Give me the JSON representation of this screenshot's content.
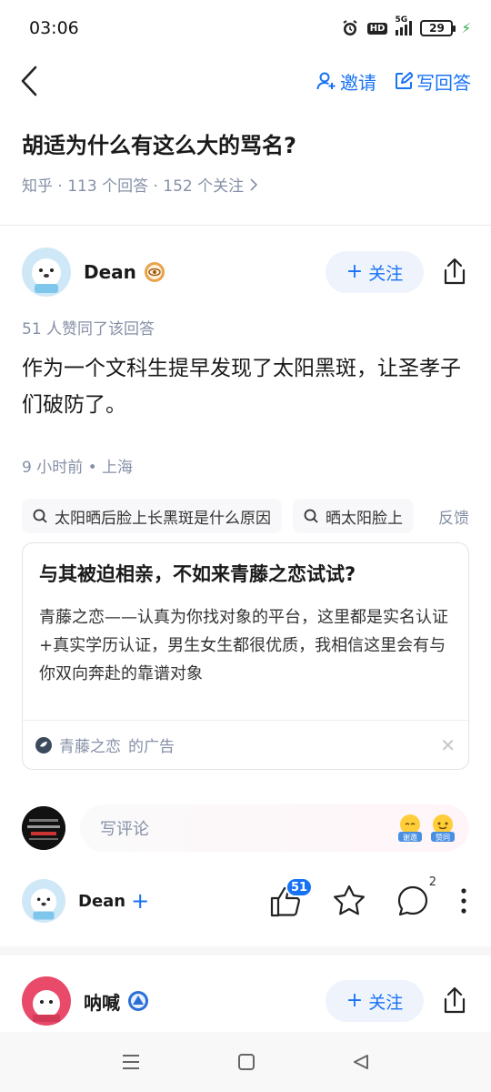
{
  "status_bar": {
    "time": "03:06",
    "hd": "HD",
    "network": "5G",
    "battery": "29"
  },
  "nav": {
    "invite_label": "邀请",
    "write_answer_label": "写回答"
  },
  "question": {
    "title": "胡适为什么有这么大的骂名?",
    "meta": "知乎 · 113 个回答 · 152 个关注"
  },
  "answer": {
    "author": "Dean",
    "follow_label": "关注",
    "likes_text": "51 人赞同了该回答",
    "content": "作为一个文科生提早发现了太阳黑斑，让圣孝子们破防了。",
    "time_location": "9 小时前 • 上海"
  },
  "search_chips": [
    "太阳晒后脸上长黑斑是什么原因",
    "晒太阳脸上"
  ],
  "feedback_label": "反馈",
  "ad": {
    "title": "与其被迫相亲，不如来青藤之恋试试?",
    "body": "青藤之恋——认真为你找对象的平台，这里都是实名认证+真实学历认证，男生女生都很优质，我相信这里会有与你双向奔赴的靠谱对象",
    "advertiser": "青藤之恋",
    "ad_suffix": "的广告"
  },
  "comment": {
    "placeholder": "写评论",
    "emoji_1": "谢邀",
    "emoji_2": "赞同"
  },
  "action_bar": {
    "author": "Dean",
    "like_count": "51",
    "comment_count": "2"
  },
  "next_answer": {
    "author": "呐喊",
    "follow_label": "关注"
  },
  "colors": {
    "accent": "#1772f6",
    "meta_gray": "#8590a6"
  }
}
